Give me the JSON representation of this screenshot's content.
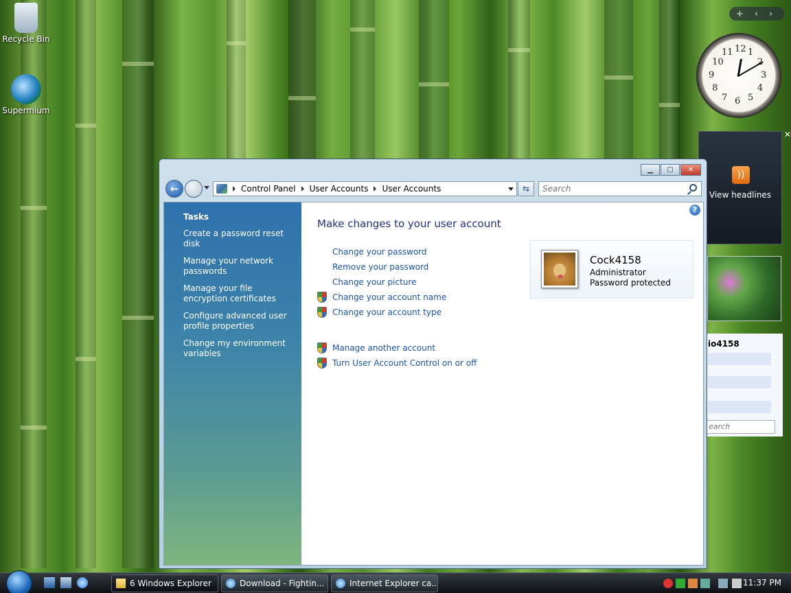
{
  "desktop": {
    "icons": [
      {
        "label": "Recycle Bin"
      },
      {
        "label": "Supermium"
      }
    ]
  },
  "window": {
    "address": {
      "crumbs": [
        "Control Panel",
        "User Accounts",
        "User Accounts"
      ]
    },
    "search": {
      "placeholder": "Search"
    },
    "tasks": {
      "heading": "Tasks",
      "items": [
        "Create a password reset disk",
        "Manage your network passwords",
        "Manage your file encryption certificates",
        "Configure advanced user profile properties",
        "Change my environment variables"
      ]
    },
    "main": {
      "title": "Make changes to your user account",
      "links": [
        {
          "label": "Change your password",
          "shield": false
        },
        {
          "label": "Remove your password",
          "shield": false
        },
        {
          "label": "Change your picture",
          "shield": false
        },
        {
          "label": "Change your account name",
          "shield": true
        },
        {
          "label": "Change your account type",
          "shield": true
        }
      ],
      "other_links": [
        {
          "label": "Manage another account",
          "shield": true
        },
        {
          "label": "Turn User Account Control on or off",
          "shield": true
        }
      ],
      "account": {
        "name": "Cock4158",
        "role": "Administrator",
        "status": "Password protected"
      }
    }
  },
  "sidebar": {
    "feed_label": "View headlines",
    "contacts_title": "io4158",
    "contacts_search": "earch",
    "clock_numbers": [
      "12",
      "1",
      "2",
      "3",
      "4",
      "5",
      "6",
      "7",
      "8",
      "9",
      "10",
      "11"
    ]
  },
  "taskbar": {
    "buttons": [
      {
        "label": "6 Windows Explorer"
      },
      {
        "label": "Download - Fightin..."
      },
      {
        "label": "Internet Explorer ca..."
      }
    ],
    "time": "11:37 PM"
  },
  "colors": {
    "link": "#1a54aa",
    "title": "#1e3287",
    "taskpane_top": "#2f71ad",
    "taskpane_bottom": "#7fb67d"
  }
}
